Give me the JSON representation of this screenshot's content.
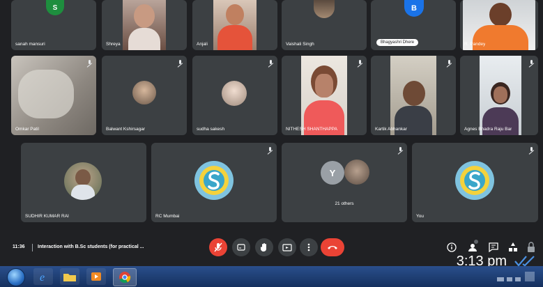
{
  "participants_row1": [
    {
      "name": "sanah mansuri",
      "kind": "letter",
      "letter": "S",
      "color": "#1e8e3e"
    },
    {
      "name": "Shreya",
      "kind": "video"
    },
    {
      "name": "Anjali",
      "kind": "video"
    },
    {
      "name": "Vaishali Singh",
      "kind": "photo"
    },
    {
      "name": "Bhagyashri Dhere",
      "kind": "letter",
      "letter": "B",
      "color": "#1a73e8",
      "pinned": true
    },
    {
      "name": "R. Pandey",
      "kind": "video"
    }
  ],
  "participants_row2": [
    {
      "name": "Omkar Patil",
      "kind": "video"
    },
    {
      "name": "Balwant Kshirsagar",
      "kind": "photo"
    },
    {
      "name": "sudha sakesh",
      "kind": "photo"
    },
    {
      "name": "NITHESH SHANTHAPPA",
      "kind": "video"
    },
    {
      "name": "Kartik Abhankar",
      "kind": "video"
    },
    {
      "name": "Agnes Bhadra Raju Bar",
      "kind": "video"
    }
  ],
  "participants_row3": [
    {
      "name": "SUDHIR KUMAR RAI",
      "kind": "photo"
    },
    {
      "name": "RC Mumbai",
      "kind": "logo"
    },
    {
      "name": "21 others",
      "kind": "others",
      "letter": "Y",
      "color": "#9aa0a6"
    },
    {
      "name": "You",
      "kind": "logo"
    }
  ],
  "meeting": {
    "time": "11:36",
    "title": "Interaction with B.Sc students (for practical ..."
  },
  "controls": [
    {
      "name": "mic-off",
      "icon": "mic-off-icon"
    },
    {
      "name": "captions",
      "icon": "captions-icon"
    },
    {
      "name": "raise-hand",
      "icon": "hand-icon"
    },
    {
      "name": "present",
      "icon": "present-icon"
    },
    {
      "name": "more",
      "icon": "more-vert-icon"
    },
    {
      "name": "leave-call",
      "icon": "phone-hangup-icon"
    }
  ],
  "clock_overlay": "3:13 pm",
  "colors": {
    "tile": "#3c4043",
    "background": "#1f2023",
    "danger": "#ea4335",
    "check": "#4a90e2"
  }
}
